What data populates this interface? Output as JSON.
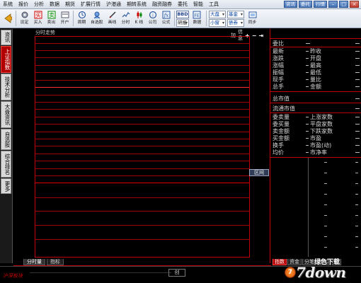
{
  "menu": {
    "items": [
      "系统",
      "报价",
      "分析",
      "数据",
      "期货",
      "扩展行情",
      "沪港通",
      "期转系统",
      "融资融券",
      "委托",
      "智能",
      "工具"
    ],
    "right_buttons": [
      "资讯",
      "委托",
      "行情"
    ]
  },
  "toolbar": {
    "buttons": [
      {
        "label": "设定",
        "icon": "settings-icon"
      },
      {
        "label": "买入",
        "icon": "buy-icon"
      },
      {
        "label": "卖出",
        "icon": "sell-icon"
      },
      {
        "label": "开户",
        "icon": "account-icon"
      },
      {
        "label": "周期",
        "icon": "cycle-icon"
      },
      {
        "label": "自选股",
        "icon": "favorites-icon"
      },
      {
        "label": "画线",
        "icon": "draw-line-icon"
      },
      {
        "label": "分时",
        "icon": "timeshare-icon"
      },
      {
        "label": "K 线",
        "icon": "kline-icon"
      },
      {
        "label": "公司",
        "icon": "company-icon"
      },
      {
        "label": "公式",
        "icon": "formula-icon"
      },
      {
        "label": "数据",
        "icon": "data-icon"
      },
      {
        "label": "同步",
        "icon": "sync-icon"
      }
    ],
    "bbd_label": "BBD",
    "research_label": "研报",
    "dropdowns": [
      "大盘",
      "小窗",
      "基金",
      "债券"
    ],
    "fe_label": "FE"
  },
  "side_tabs": [
    "资讯",
    "上证指数",
    "技术分析",
    "大盘资讯",
    "自选股",
    "综合排名",
    "更多"
  ],
  "side_active": 1,
  "chart": {
    "title": "分时走势",
    "controls": {
      "add": "加",
      "info": "信息"
    },
    "range_button": "区间",
    "bottom_tabs": [
      "分时量",
      "指标"
    ]
  },
  "quote_panel": {
    "rows1": [
      {
        "left": "委比",
        "right": ""
      },
      {
        "left": "最新",
        "right": "昨收"
      },
      {
        "left": "涨跌",
        "right": "开盘"
      },
      {
        "left": "涨幅",
        "right": "最高"
      },
      {
        "left": "振幅",
        "right": "最低"
      },
      {
        "left": "现手",
        "right": "量比"
      },
      {
        "left": "总手",
        "right": "金额"
      }
    ],
    "rows2": [
      {
        "left": "总市值",
        "right": ""
      },
      {
        "left": "流通市值",
        "right": ""
      }
    ],
    "rows3": [
      {
        "left": "委卖量",
        "right": "上涨家数"
      },
      {
        "left": "委买量",
        "right": "平盘家数"
      },
      {
        "left": "卖金额",
        "right": "下跌家数"
      },
      {
        "left": "买金额",
        "right": "市盈"
      },
      {
        "left": "换手",
        "right": "市盈(动)"
      },
      {
        "left": "均价",
        "right": "市净率"
      }
    ],
    "tabs": [
      "指数",
      "资金",
      "分笔",
      "盘口",
      "值"
    ]
  },
  "status": {
    "left_text": "沪深板块",
    "center_text": "创"
  },
  "watermark": {
    "logo": "7down",
    "sub": "绿色下载",
    "badge": "7"
  },
  "colors": {
    "grid_red": "#c0000a",
    "active_tab": "#b20000",
    "background": "#000000"
  }
}
